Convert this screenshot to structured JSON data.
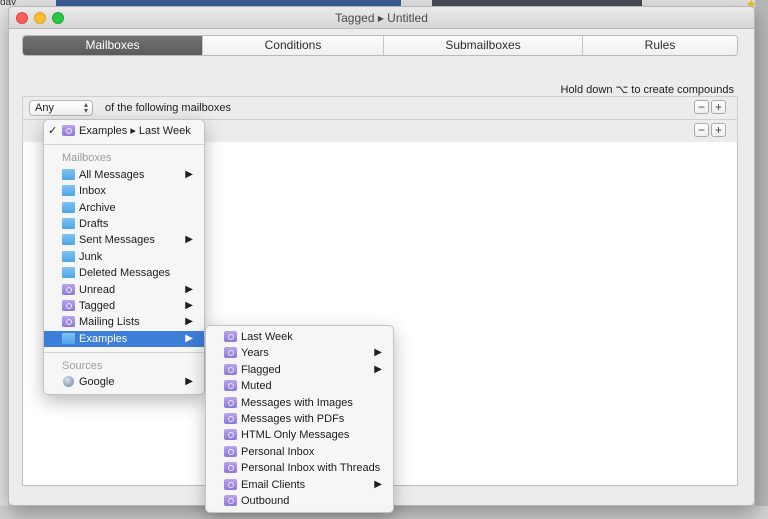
{
  "background": {
    "corner_text": "dav"
  },
  "window": {
    "title": "Tagged ▸ Untitled"
  },
  "tabs": [
    {
      "label": "Mailboxes",
      "active": true
    },
    {
      "label": "Conditions",
      "active": false
    },
    {
      "label": "Submailboxes",
      "active": false
    },
    {
      "label": "Rules",
      "active": false
    }
  ],
  "hint": "Hold down ⌥ to create compounds",
  "criteria": {
    "match_select": "Any",
    "match_text": "of the following mailboxes",
    "minus": "−",
    "plus": "+"
  },
  "mailbox_menu": {
    "selected_item": "Examples ▸ Last Week",
    "check": "✓",
    "mailboxes_header": "Mailboxes",
    "items": [
      {
        "label": "All Messages",
        "icon": "folder-blue-icon",
        "submenu": true
      },
      {
        "label": "Inbox",
        "icon": "folder-blue-icon",
        "submenu": false
      },
      {
        "label": "Archive",
        "icon": "folder-blue-icon",
        "submenu": false
      },
      {
        "label": "Drafts",
        "icon": "folder-blue-icon",
        "submenu": false
      },
      {
        "label": "Sent Messages",
        "icon": "folder-blue-icon",
        "submenu": true
      },
      {
        "label": "Junk",
        "icon": "folder-blue-icon",
        "submenu": false
      },
      {
        "label": "Deleted Messages",
        "icon": "folder-blue-icon",
        "submenu": false
      },
      {
        "label": "Unread",
        "icon": "smart-folder-icon",
        "submenu": true
      },
      {
        "label": "Tagged",
        "icon": "smart-folder-icon",
        "submenu": true
      },
      {
        "label": "Mailing Lists",
        "icon": "smart-folder-icon",
        "submenu": true
      },
      {
        "label": "Examples",
        "icon": "folder-blue-icon",
        "submenu": true,
        "highlighted": true
      }
    ],
    "sources_header": "Sources",
    "sources": [
      {
        "label": "Google",
        "icon": "globe-icon",
        "submenu": true
      }
    ],
    "submenu_arrow": "▶"
  },
  "examples_submenu": {
    "items": [
      {
        "label": "Last Week",
        "submenu": false
      },
      {
        "label": "Years",
        "submenu": true
      },
      {
        "label": "Flagged",
        "submenu": true
      },
      {
        "label": "Muted",
        "submenu": false
      },
      {
        "label": "Messages with Images",
        "submenu": false
      },
      {
        "label": "Messages with PDFs",
        "submenu": false
      },
      {
        "label": "HTML Only Messages",
        "submenu": false
      },
      {
        "label": "Personal Inbox",
        "submenu": false
      },
      {
        "label": "Personal Inbox with Threads",
        "submenu": false
      },
      {
        "label": "Email Clients",
        "submenu": true
      },
      {
        "label": "Outbound",
        "submenu": false
      }
    ]
  },
  "colors": {
    "highlight": "#3d7ed8",
    "folder_blue": "#5aaee9",
    "smart_folder_purple": "#9a82de"
  }
}
